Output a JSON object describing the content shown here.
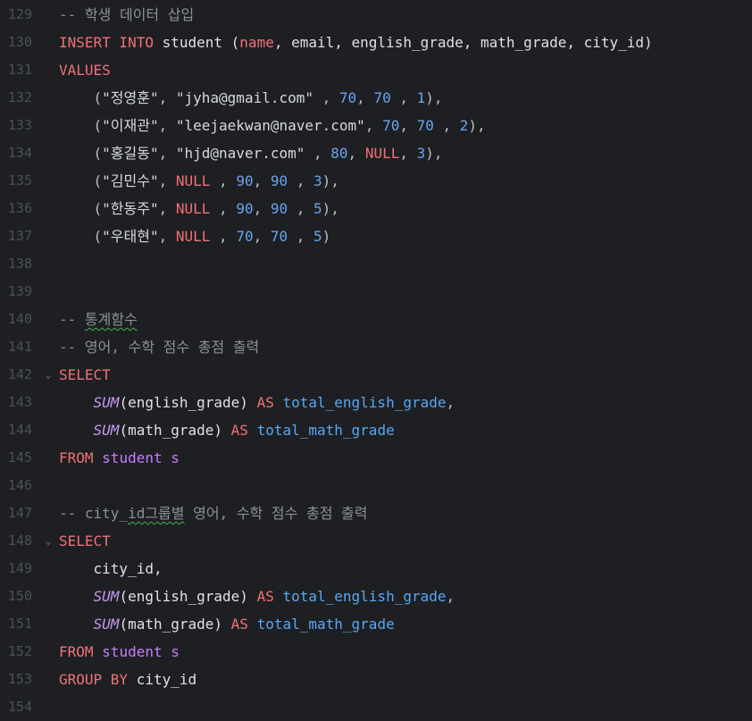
{
  "editor": {
    "lines": [
      {
        "num": "129",
        "fold": "",
        "tokens": [
          {
            "t": "-- 학생 데이터 삽입",
            "c": "cmt"
          }
        ]
      },
      {
        "num": "130",
        "fold": "",
        "tokens": [
          {
            "t": "INSERT INTO ",
            "c": "kw2"
          },
          {
            "t": "student (",
            "c": "ident"
          },
          {
            "t": "name",
            "c": "kw2"
          },
          {
            "t": ", email, english_grade, math_grade, city_id)",
            "c": "ident"
          }
        ]
      },
      {
        "num": "131",
        "fold": "",
        "tokens": [
          {
            "t": "VALUES",
            "c": "kw2"
          }
        ]
      },
      {
        "num": "132",
        "fold": "",
        "tokens": [
          {
            "t": "    (",
            "c": "punct"
          },
          {
            "t": "\"정영훈\"",
            "c": "str"
          },
          {
            "t": ", ",
            "c": "punct"
          },
          {
            "t": "\"jyha@gmail.com\"",
            "c": "str"
          },
          {
            "t": " , ",
            "c": "punct"
          },
          {
            "t": "70",
            "c": "num"
          },
          {
            "t": ", ",
            "c": "punct"
          },
          {
            "t": "70",
            "c": "num"
          },
          {
            "t": " , ",
            "c": "punct"
          },
          {
            "t": "1",
            "c": "num"
          },
          {
            "t": "),",
            "c": "punct"
          }
        ]
      },
      {
        "num": "133",
        "fold": "",
        "tokens": [
          {
            "t": "    (",
            "c": "punct"
          },
          {
            "t": "\"이재관\"",
            "c": "str"
          },
          {
            "t": ", ",
            "c": "punct"
          },
          {
            "t": "\"leejaekwan@naver.com\"",
            "c": "str"
          },
          {
            "t": ", ",
            "c": "punct"
          },
          {
            "t": "70",
            "c": "num"
          },
          {
            "t": ", ",
            "c": "punct"
          },
          {
            "t": "70",
            "c": "num"
          },
          {
            "t": " , ",
            "c": "punct"
          },
          {
            "t": "2",
            "c": "num"
          },
          {
            "t": "),",
            "c": "punct"
          }
        ]
      },
      {
        "num": "134",
        "fold": "",
        "tokens": [
          {
            "t": "    (",
            "c": "punct"
          },
          {
            "t": "\"홍길동\"",
            "c": "str"
          },
          {
            "t": ", ",
            "c": "punct"
          },
          {
            "t": "\"hjd@naver.com\"",
            "c": "str"
          },
          {
            "t": " , ",
            "c": "punct"
          },
          {
            "t": "80",
            "c": "num"
          },
          {
            "t": ", ",
            "c": "punct"
          },
          {
            "t": "NULL",
            "c": "null"
          },
          {
            "t": ", ",
            "c": "punct"
          },
          {
            "t": "3",
            "c": "num"
          },
          {
            "t": "),",
            "c": "punct"
          }
        ]
      },
      {
        "num": "135",
        "fold": "",
        "tokens": [
          {
            "t": "    (",
            "c": "punct"
          },
          {
            "t": "\"김민수\"",
            "c": "str"
          },
          {
            "t": ", ",
            "c": "punct"
          },
          {
            "t": "NULL",
            "c": "null"
          },
          {
            "t": " , ",
            "c": "punct"
          },
          {
            "t": "90",
            "c": "num"
          },
          {
            "t": ", ",
            "c": "punct"
          },
          {
            "t": "90",
            "c": "num"
          },
          {
            "t": " , ",
            "c": "punct"
          },
          {
            "t": "3",
            "c": "num"
          },
          {
            "t": "),",
            "c": "punct"
          }
        ]
      },
      {
        "num": "136",
        "fold": "",
        "tokens": [
          {
            "t": "    (",
            "c": "punct"
          },
          {
            "t": "\"한동주\"",
            "c": "str"
          },
          {
            "t": ", ",
            "c": "punct"
          },
          {
            "t": "NULL",
            "c": "null"
          },
          {
            "t": " , ",
            "c": "punct"
          },
          {
            "t": "90",
            "c": "num"
          },
          {
            "t": ", ",
            "c": "punct"
          },
          {
            "t": "90",
            "c": "num"
          },
          {
            "t": " , ",
            "c": "punct"
          },
          {
            "t": "5",
            "c": "num"
          },
          {
            "t": "),",
            "c": "punct"
          }
        ]
      },
      {
        "num": "137",
        "fold": "",
        "tokens": [
          {
            "t": "    (",
            "c": "punct"
          },
          {
            "t": "\"우태현\"",
            "c": "str"
          },
          {
            "t": ", ",
            "c": "punct"
          },
          {
            "t": "NULL",
            "c": "null"
          },
          {
            "t": " , ",
            "c": "punct"
          },
          {
            "t": "70",
            "c": "num"
          },
          {
            "t": ", ",
            "c": "punct"
          },
          {
            "t": "70",
            "c": "num"
          },
          {
            "t": " , ",
            "c": "punct"
          },
          {
            "t": "5",
            "c": "num"
          },
          {
            "t": ")",
            "c": "punct"
          }
        ]
      },
      {
        "num": "138",
        "fold": "",
        "tokens": []
      },
      {
        "num": "139",
        "fold": "",
        "tokens": []
      },
      {
        "num": "140",
        "fold": "",
        "tokens": [
          {
            "t": "-- ",
            "c": "cmt"
          },
          {
            "t": "통계함수",
            "c": "cmt squiggle"
          }
        ]
      },
      {
        "num": "141",
        "fold": "",
        "tokens": [
          {
            "t": "-- 영어, 수학 점수 총점 출력",
            "c": "cmt"
          }
        ]
      },
      {
        "num": "142",
        "fold": "⌄",
        "tokens": [
          {
            "t": "SELECT",
            "c": "kw2"
          }
        ]
      },
      {
        "num": "143",
        "fold": "",
        "tokens": [
          {
            "t": "    ",
            "c": "punct"
          },
          {
            "t": "SUM",
            "c": "fn"
          },
          {
            "t": "(english_grade) ",
            "c": "ident"
          },
          {
            "t": "AS ",
            "c": "kw2"
          },
          {
            "t": "total_english_grade",
            "c": "alias"
          },
          {
            "t": ",",
            "c": "punct"
          }
        ]
      },
      {
        "num": "144",
        "fold": "",
        "tokens": [
          {
            "t": "    ",
            "c": "punct"
          },
          {
            "t": "SUM",
            "c": "fn"
          },
          {
            "t": "(math_grade) ",
            "c": "ident"
          },
          {
            "t": "AS ",
            "c": "kw2"
          },
          {
            "t": "total_math_grade",
            "c": "alias"
          }
        ]
      },
      {
        "num": "145",
        "fold": "",
        "tokens": [
          {
            "t": "FROM ",
            "c": "kw2"
          },
          {
            "t": "student s",
            "c": "tbl"
          }
        ]
      },
      {
        "num": "146",
        "fold": "",
        "tokens": []
      },
      {
        "num": "147",
        "fold": "",
        "tokens": [
          {
            "t": "-- city_",
            "c": "cmt"
          },
          {
            "t": "id그룹별",
            "c": "cmt squiggle"
          },
          {
            "t": " 영어, 수학 점수 총점 출력",
            "c": "cmt"
          }
        ]
      },
      {
        "num": "148",
        "fold": "⌄",
        "tokens": [
          {
            "t": "SELECT",
            "c": "kw2"
          }
        ]
      },
      {
        "num": "149",
        "fold": "",
        "tokens": [
          {
            "t": "    city_id,",
            "c": "ident"
          }
        ]
      },
      {
        "num": "150",
        "fold": "",
        "tokens": [
          {
            "t": "    ",
            "c": "punct"
          },
          {
            "t": "SUM",
            "c": "fn"
          },
          {
            "t": "(english_grade) ",
            "c": "ident"
          },
          {
            "t": "AS ",
            "c": "kw2"
          },
          {
            "t": "total_english_grade",
            "c": "alias"
          },
          {
            "t": ",",
            "c": "punct"
          }
        ]
      },
      {
        "num": "151",
        "fold": "",
        "tokens": [
          {
            "t": "    ",
            "c": "punct"
          },
          {
            "t": "SUM",
            "c": "fn"
          },
          {
            "t": "(math_grade) ",
            "c": "ident"
          },
          {
            "t": "AS ",
            "c": "kw2"
          },
          {
            "t": "total_math_grade",
            "c": "alias"
          }
        ]
      },
      {
        "num": "152",
        "fold": "",
        "tokens": [
          {
            "t": "FROM ",
            "c": "kw2"
          },
          {
            "t": "student s",
            "c": "tbl"
          }
        ]
      },
      {
        "num": "153",
        "fold": "",
        "tokens": [
          {
            "t": "GROUP BY ",
            "c": "kw2"
          },
          {
            "t": "city_id",
            "c": "ident"
          }
        ]
      },
      {
        "num": "154",
        "fold": "",
        "tokens": []
      }
    ]
  }
}
